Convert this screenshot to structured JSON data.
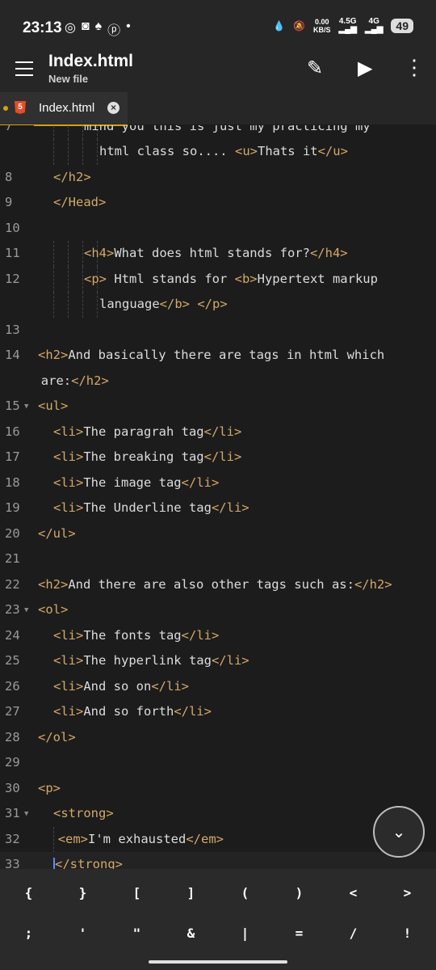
{
  "status": {
    "time": "23:13",
    "icons": [
      "whatsapp-icon",
      "discord-icon",
      "snapchat-icon",
      "pinterest-icon",
      "dot"
    ],
    "net_speed": "0.00",
    "net_unit": "KB/S",
    "signal1": "4.5G",
    "signal2": "4G",
    "battery": "49"
  },
  "appbar": {
    "title": "Index.html",
    "subtitle": "New file"
  },
  "tab": {
    "label": "Index.html",
    "icon_text": "5"
  },
  "editor": {
    "lines": [
      {
        "num": "7",
        "text": "mind you this is just my practicing my"
      },
      {
        "num": "",
        "text": "html class so.... <u>Thats it</u>"
      },
      {
        "num": "8",
        "text": "</h2>"
      },
      {
        "num": "9",
        "text": "</Head>"
      },
      {
        "num": "10",
        "text": ""
      },
      {
        "num": "11",
        "text": "<h4>What does html stands for?</h4>"
      },
      {
        "num": "12",
        "text": "<p> Html stands for <b>Hypertext markup"
      },
      {
        "num": "",
        "text": "language</b> </p>"
      },
      {
        "num": "13",
        "text": ""
      },
      {
        "num": "14",
        "text": "<h2>And basically there are tags in html which"
      },
      {
        "num": "",
        "text": "are:</h2>"
      },
      {
        "num": "15",
        "text": "<ul>"
      },
      {
        "num": "16",
        "text": "<li>The paragrah tag</li>"
      },
      {
        "num": "17",
        "text": "<li>The breaking tag</li>"
      },
      {
        "num": "18",
        "text": "<li>The image tag</li>"
      },
      {
        "num": "19",
        "text": "<li>The Underline tag</li>"
      },
      {
        "num": "20",
        "text": "</ul>"
      },
      {
        "num": "21",
        "text": ""
      },
      {
        "num": "22",
        "text": "<h2>And there are also other tags such as:</h2>"
      },
      {
        "num": "23",
        "text": "<ol>"
      },
      {
        "num": "24",
        "text": "<li>The fonts tag</li>"
      },
      {
        "num": "25",
        "text": "<li>The hyperlink tag</li>"
      },
      {
        "num": "26",
        "text": "<li>And so on</li>"
      },
      {
        "num": "27",
        "text": "<li>And so forth</li>"
      },
      {
        "num": "28",
        "text": "</ol>"
      },
      {
        "num": "29",
        "text": ""
      },
      {
        "num": "30",
        "text": "<p>"
      },
      {
        "num": "31",
        "text": "<strong>"
      },
      {
        "num": "32",
        "text": "<em>I'm exhausted</em>"
      },
      {
        "num": "33",
        "text": "</strong>"
      }
    ]
  },
  "symbols": {
    "row1": [
      "{",
      "}",
      "[",
      "]",
      "(",
      ")",
      "<",
      ">"
    ],
    "row2": [
      ";",
      "'",
      "\"",
      "&",
      "|",
      "=",
      "/",
      "!"
    ]
  }
}
